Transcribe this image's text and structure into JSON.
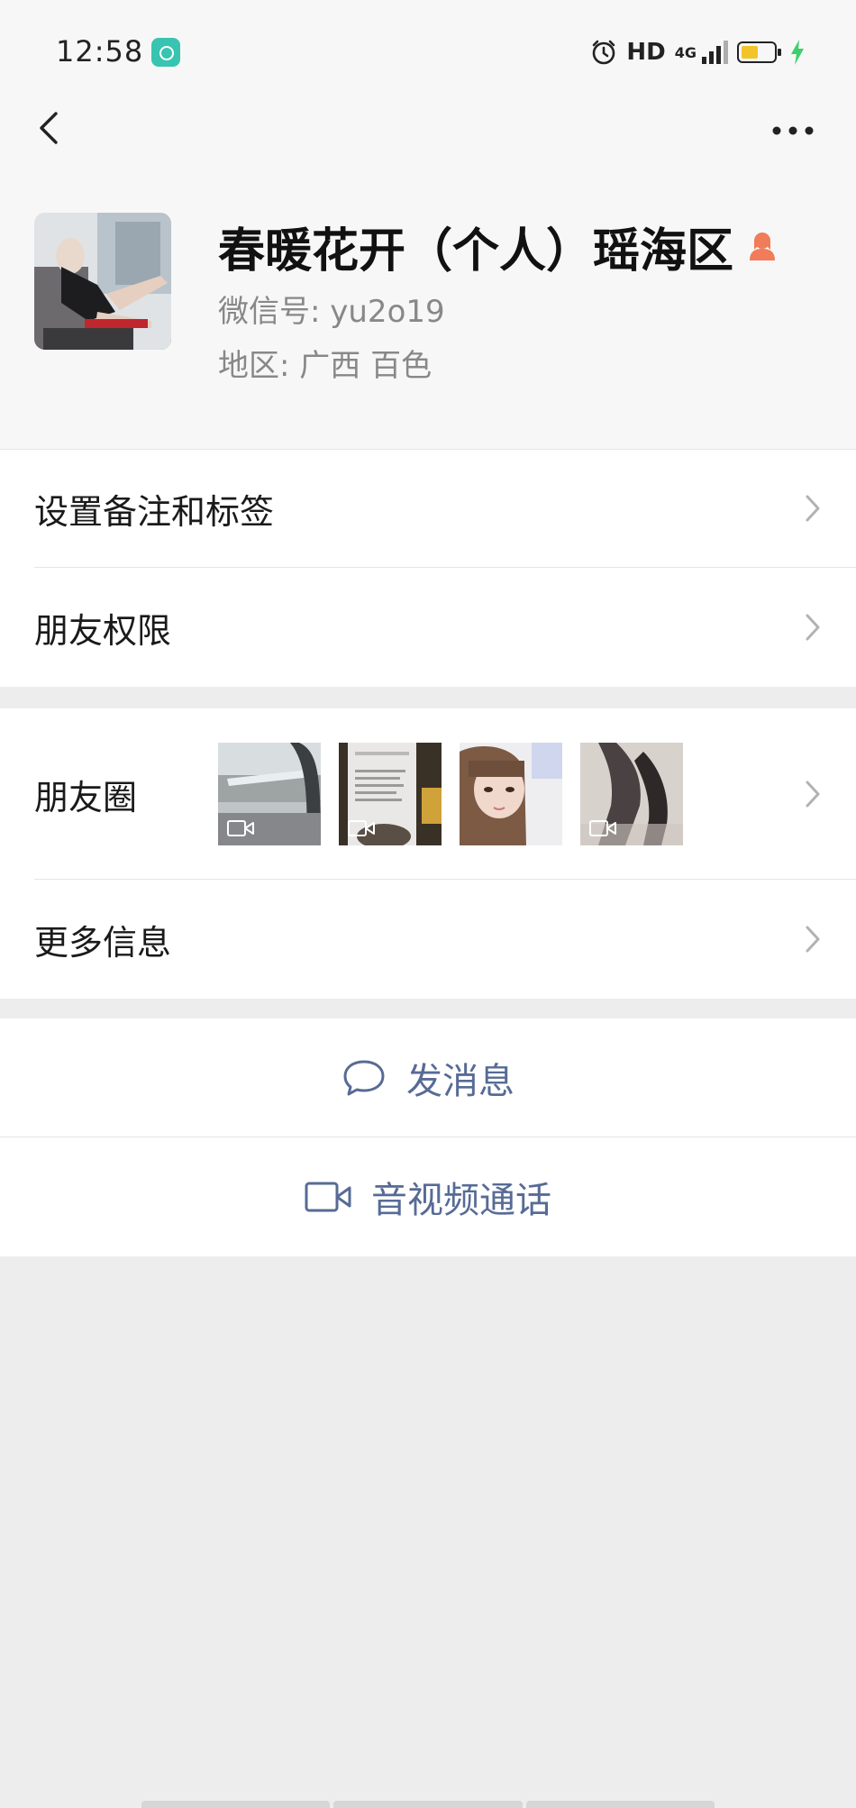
{
  "status_bar": {
    "time": "12:58",
    "hd": "HD",
    "network": "4G"
  },
  "profile": {
    "name": "春暖花开（个人）瑶海区",
    "wechat_id": "微信号: yu2o19",
    "region": "地区: 广西  百色"
  },
  "menu": {
    "remarks_tags": "设置备注和标签",
    "friend_permissions": "朋友权限",
    "moments": "朋友圈",
    "more_info": "更多信息"
  },
  "actions": {
    "send_message": "发消息",
    "av_call": "音视频通话"
  },
  "colors": {
    "link": "#576b95",
    "background": "#ededed",
    "battery": "#f3c32a",
    "charging": "#3bd06b",
    "gender_icon": "#f07c5a",
    "app_badge": "#38c4b0"
  }
}
